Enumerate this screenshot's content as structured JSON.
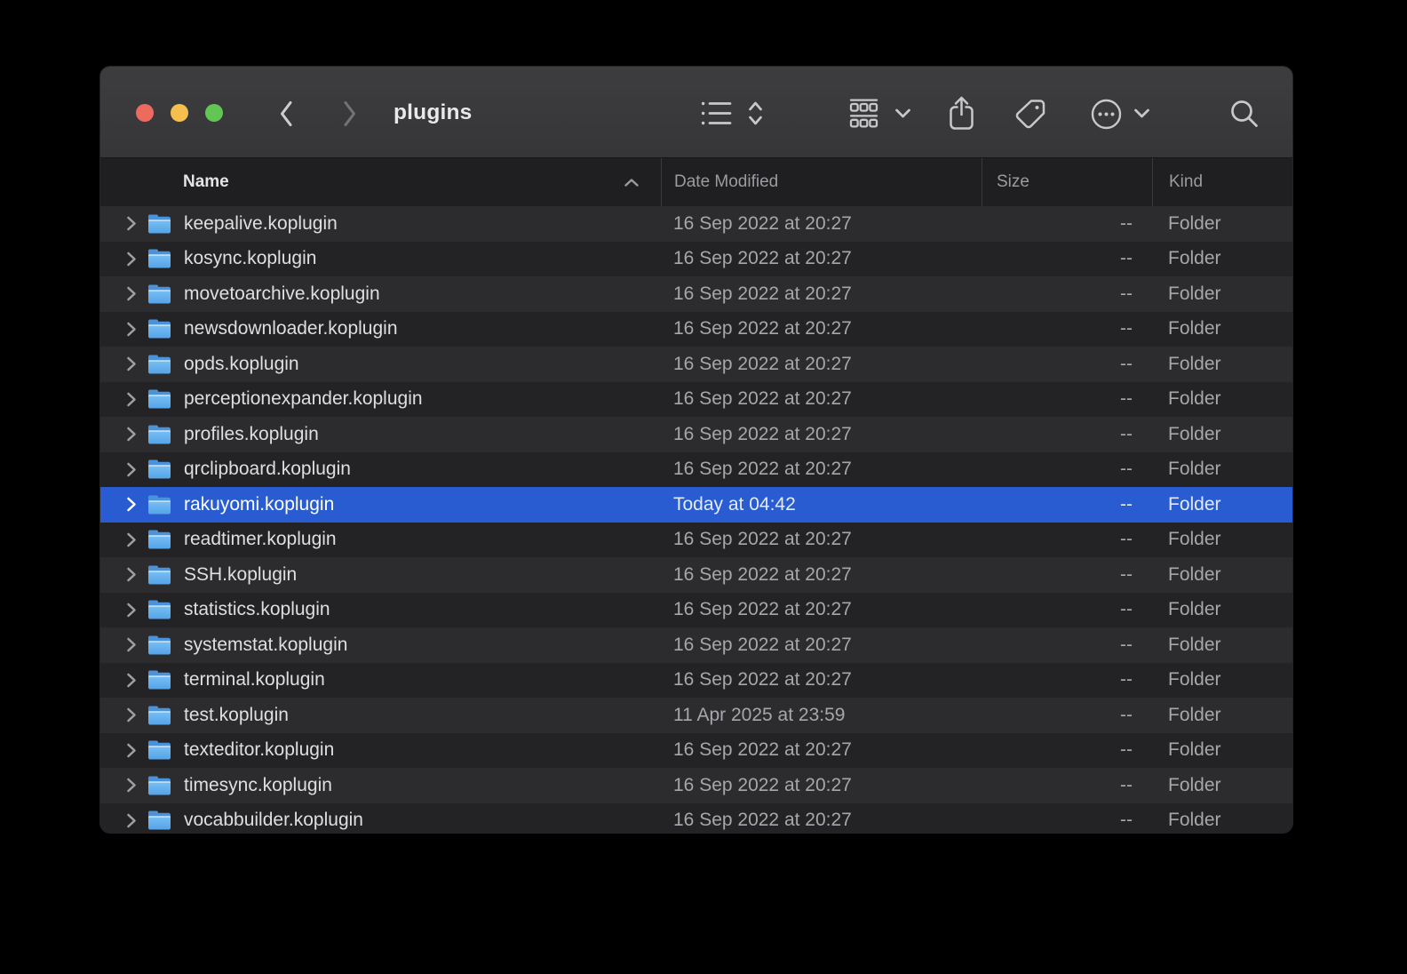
{
  "window": {
    "title": "plugins"
  },
  "titlebar": {
    "traffic_lights": [
      "close-button",
      "minimize-button",
      "zoom-button"
    ],
    "nav": [
      "back-icon",
      "forward-icon"
    ],
    "toolbar_icons": [
      "list-view-icon",
      "view-updown-chevrons-icon",
      "group-by-icon",
      "chevron-down-icon",
      "share-icon",
      "tag-icon",
      "more-options-icon",
      "chevron-down-icon",
      "search-icon"
    ]
  },
  "columns": {
    "name": "Name",
    "date_modified": "Date Modified",
    "size": "Size",
    "kind": "Kind",
    "sort_column": "Name",
    "sort_direction": "ascending"
  },
  "rows": [
    {
      "name": "keepalive.koplugin",
      "date_modified": "16 Sep 2022 at 20:27",
      "size": "--",
      "kind": "Folder",
      "selected": false
    },
    {
      "name": "kosync.koplugin",
      "date_modified": "16 Sep 2022 at 20:27",
      "size": "--",
      "kind": "Folder",
      "selected": false
    },
    {
      "name": "movetoarchive.koplugin",
      "date_modified": "16 Sep 2022 at 20:27",
      "size": "--",
      "kind": "Folder",
      "selected": false
    },
    {
      "name": "newsdownloader.koplugin",
      "date_modified": "16 Sep 2022 at 20:27",
      "size": "--",
      "kind": "Folder",
      "selected": false
    },
    {
      "name": "opds.koplugin",
      "date_modified": "16 Sep 2022 at 20:27",
      "size": "--",
      "kind": "Folder",
      "selected": false
    },
    {
      "name": "perceptionexpander.koplugin",
      "date_modified": "16 Sep 2022 at 20:27",
      "size": "--",
      "kind": "Folder",
      "selected": false
    },
    {
      "name": "profiles.koplugin",
      "date_modified": "16 Sep 2022 at 20:27",
      "size": "--",
      "kind": "Folder",
      "selected": false
    },
    {
      "name": "qrclipboard.koplugin",
      "date_modified": "16 Sep 2022 at 20:27",
      "size": "--",
      "kind": "Folder",
      "selected": false
    },
    {
      "name": "rakuyomi.koplugin",
      "date_modified": "Today at 04:42",
      "size": "--",
      "kind": "Folder",
      "selected": true
    },
    {
      "name": "readtimer.koplugin",
      "date_modified": "16 Sep 2022 at 20:27",
      "size": "--",
      "kind": "Folder",
      "selected": false
    },
    {
      "name": "SSH.koplugin",
      "date_modified": "16 Sep 2022 at 20:27",
      "size": "--",
      "kind": "Folder",
      "selected": false
    },
    {
      "name": "statistics.koplugin",
      "date_modified": "16 Sep 2022 at 20:27",
      "size": "--",
      "kind": "Folder",
      "selected": false
    },
    {
      "name": "systemstat.koplugin",
      "date_modified": "16 Sep 2022 at 20:27",
      "size": "--",
      "kind": "Folder",
      "selected": false
    },
    {
      "name": "terminal.koplugin",
      "date_modified": "16 Sep 2022 at 20:27",
      "size": "--",
      "kind": "Folder",
      "selected": false
    },
    {
      "name": "test.koplugin",
      "date_modified": "11 Apr 2025 at 23:59",
      "size": "--",
      "kind": "Folder",
      "selected": false
    },
    {
      "name": "texteditor.koplugin",
      "date_modified": "16 Sep 2022 at 20:27",
      "size": "--",
      "kind": "Folder",
      "selected": false
    },
    {
      "name": "timesync.koplugin",
      "date_modified": "16 Sep 2022 at 20:27",
      "size": "--",
      "kind": "Folder",
      "selected": false
    },
    {
      "name": "vocabbuilder.koplugin",
      "date_modified": "16 Sep 2022 at 20:27",
      "size": "--",
      "kind": "Folder",
      "selected": false
    }
  ],
  "colors": {
    "selection_blue": "#2a5cd1",
    "row_light": "#2c2c2e",
    "row_dark": "#232325",
    "header_bg": "#1f1f21",
    "titlebar_bg": "#39393b",
    "window_border": "rgba(255,255,255,0.14)",
    "traffic_close": "#ed6a5f",
    "traffic_minimize": "#f4bf4f",
    "traffic_zoom": "#62c554",
    "folder_blue": "#55a3e8",
    "text_primary": "#dfdfe1",
    "text_secondary": "#a7a7ab"
  }
}
